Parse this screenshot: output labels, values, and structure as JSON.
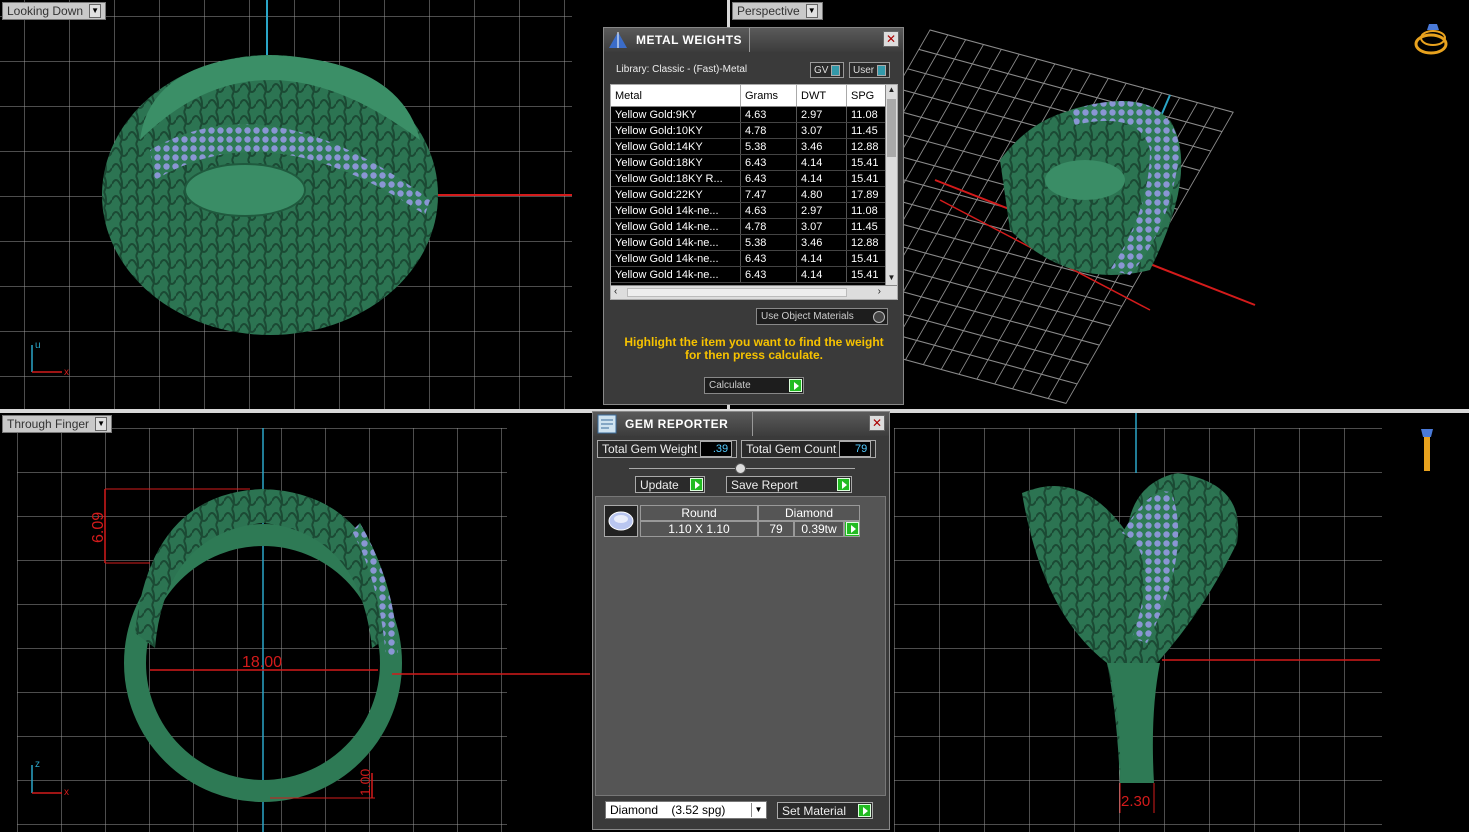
{
  "viewports": {
    "top_left": {
      "label": "Looking Down"
    },
    "top_right": {
      "label": "Perspective"
    },
    "bottom_left": {
      "label": "Through Finger"
    },
    "bottom_right": {
      "label": ""
    }
  },
  "axes": {
    "u": "u",
    "x": "x",
    "z": "z"
  },
  "dimensions": {
    "width_top": "6.09",
    "diameter": "18.00",
    "bottom_thickness": "1.00",
    "shank_width": "2.30"
  },
  "metal_weights": {
    "title": "METAL WEIGHTS",
    "library": "Library: Classic - (Fast)-Metal",
    "gv_label": "GV",
    "user_label": "User",
    "columns": [
      "Metal",
      "Grams",
      "DWT",
      "SPG"
    ],
    "rows": [
      [
        "Yellow Gold:9KY",
        "4.63",
        "2.97",
        "11.08"
      ],
      [
        "Yellow Gold:10KY",
        "4.78",
        "3.07",
        "11.45"
      ],
      [
        "Yellow Gold:14KY",
        "5.38",
        "3.46",
        "12.88"
      ],
      [
        "Yellow Gold:18KY",
        "6.43",
        "4.14",
        "15.41"
      ],
      [
        "Yellow Gold:18KY R...",
        "6.43",
        "4.14",
        "15.41"
      ],
      [
        "Yellow Gold:22KY",
        "7.47",
        "4.80",
        "17.89"
      ],
      [
        "Yellow Gold 14k-ne...",
        "4.63",
        "2.97",
        "11.08"
      ],
      [
        "Yellow Gold 14k-ne...",
        "4.78",
        "3.07",
        "11.45"
      ],
      [
        "Yellow Gold 14k-ne...",
        "5.38",
        "3.46",
        "12.88"
      ],
      [
        "Yellow Gold 14k-ne...",
        "6.43",
        "4.14",
        "15.41"
      ],
      [
        "Yellow Gold 14k-ne...",
        "6.43",
        "4.14",
        "15.41"
      ]
    ],
    "use_object_materials": "Use Object Materials",
    "message": "Highlight the item you want to find the weight for then press calculate.",
    "calculate": "Calculate"
  },
  "gem_reporter": {
    "title": "GEM REPORTER",
    "total_gem_weight_label": "Total Gem Weight",
    "total_gem_weight": ".39",
    "total_gem_count_label": "Total Gem Count",
    "total_gem_count": "79",
    "update": "Update",
    "save_report": "Save Report",
    "table_head": [
      "Round",
      "Diamond"
    ],
    "table_row": [
      "1.10 X 1.10",
      "79",
      "0.39tw"
    ],
    "material": "Diamond    (3.52 spg)",
    "set_material": "Set Material"
  },
  "colors": {
    "ring": "#2e7a55",
    "gems": "#8a9ad8",
    "dimension": "#e01b1b",
    "axis": "#2aa6c8"
  }
}
